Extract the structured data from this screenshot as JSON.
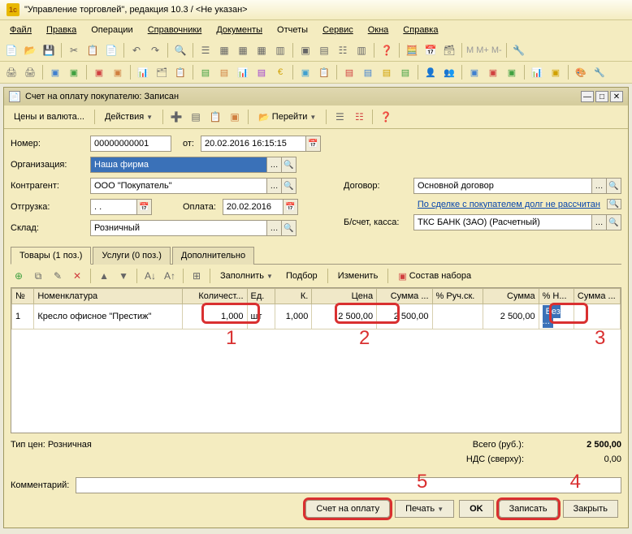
{
  "app": {
    "title": "\"Управление торговлей\", редакция 10.3 / <Не указан>"
  },
  "menu": [
    "Файл",
    "Правка",
    "Операции",
    "Справочники",
    "Документы",
    "Отчеты",
    "Сервис",
    "Окна",
    "Справка"
  ],
  "doc": {
    "title": "Счет на оплату покупателю: Записан",
    "toolbar": {
      "prices": "Цены и валюта...",
      "actions": "Действия",
      "goto": "Перейти"
    }
  },
  "form": {
    "number_label": "Номер:",
    "number": "00000000001",
    "from_label": "от:",
    "datetime": "20.02.2016 16:15:15",
    "org_label": "Организация:",
    "org": "Наша фирма",
    "contragent_label": "Контрагент:",
    "contragent": "ООО \"Покупатель\"",
    "ship_label": "Отгрузка:",
    "ship": ". .",
    "pay_label": "Оплата:",
    "pay_date": "20.02.2016",
    "warehouse_label": "Склад:",
    "warehouse": "Розничный",
    "contract_label": "Договор:",
    "contract": "Основной договор",
    "deal_link": "По сделке с покупателем долг не рассчитан",
    "bank_label": "Б/счет, касса:",
    "bank": "ТКС БАНК (ЗАО) (Расчетный)"
  },
  "tabs": {
    "goods": "Товары (1 поз.)",
    "services": "Услуги (0 поз.)",
    "extra": "Дополнительно"
  },
  "table_toolbar": {
    "fill": "Заполнить",
    "select": "Подбор",
    "change": "Изменить",
    "composition": "Состав набора"
  },
  "grid": {
    "headers": [
      "№",
      "Номенклатура",
      "Количест...",
      "Ед.",
      "К.",
      "Цена",
      "Сумма ...",
      "% Руч.ск.",
      "Сумма",
      "% Н...",
      "Сумма ..."
    ],
    "row": {
      "n": "1",
      "name": "Кресло офисное \"Престиж\"",
      "qty": "1,000",
      "unit": "шт",
      "k": "1,000",
      "price": "2 500,00",
      "sum1": "2 500,00",
      "disc": "",
      "sum2": "2 500,00",
      "vat": "Без ...",
      "sum3": ""
    }
  },
  "totals": {
    "price_type_label": "Тип цен: Розничная",
    "total_label": "Всего (руб.):",
    "total": "2 500,00",
    "vat_label": "НДС (сверху):",
    "vat": "0,00"
  },
  "comment_label": "Комментарий:",
  "buttons": {
    "invoice": "Счет на оплату",
    "print": "Печать",
    "ok": "OK",
    "save": "Записать",
    "close": "Закрыть"
  },
  "callouts": {
    "c1": "1",
    "c2": "2",
    "c3": "3",
    "c4": "4",
    "c5": "5"
  }
}
